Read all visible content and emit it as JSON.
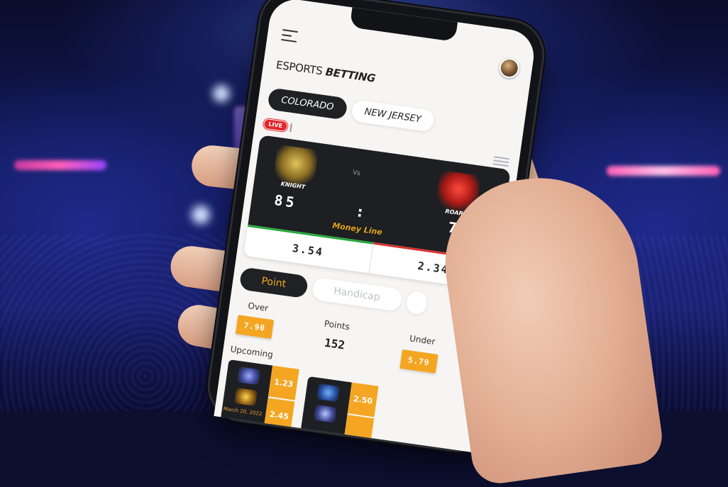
{
  "app": {
    "title_light": "ESPORTS",
    "title_bold": "BETTING"
  },
  "state_tabs": [
    {
      "label": "COLORADO",
      "active": true
    },
    {
      "label": "NEW JERSEY",
      "active": false
    }
  ],
  "live_label": "LIVE",
  "match": {
    "team_a": {
      "name": "KNIGHT",
      "score": "85"
    },
    "team_b": {
      "name": "ROAR",
      "score": "79"
    },
    "vs_label": "Vs",
    "separator": ":",
    "market_label": "Money Line",
    "odds_a": "3.54",
    "odds_b": "2.34"
  },
  "bet_tabs": [
    {
      "label": "Point",
      "active": true
    },
    {
      "label": "Handicap",
      "active": false
    }
  ],
  "totals": {
    "over_label": "Over",
    "over_odds": "7.90",
    "points_label": "Points",
    "points_value": "152",
    "under_label": "Under",
    "under_odds": "5.79"
  },
  "upcoming": {
    "label": "Upcoming",
    "cards": [
      {
        "odds": [
          "1.23",
          "2.45"
        ],
        "date": "March 20, 2022"
      },
      {
        "odds": [
          "2.50",
          ""
        ]
      }
    ]
  },
  "colors": {
    "accent": "#f4a623",
    "dark": "#1f2124",
    "live": "#e3262c",
    "odds_up": "#27a83a",
    "odds_down": "#d8312f"
  }
}
